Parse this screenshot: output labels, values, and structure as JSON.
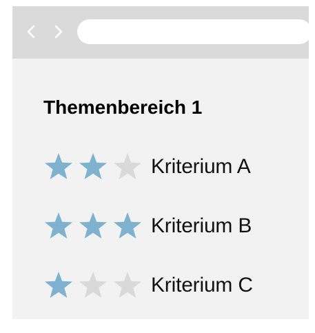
{
  "browser": {
    "back_icon": "chevron-left-icon",
    "forward_icon": "chevron-right-icon",
    "address_value": ""
  },
  "section": {
    "title": "Themenbereich 1"
  },
  "criteria": [
    {
      "label": "Kriterium A",
      "rating": 2,
      "max": 3
    },
    {
      "label": "Kriterium B",
      "rating": 3,
      "max": 3
    },
    {
      "label": "Kriterium C",
      "rating": 1,
      "max": 3
    }
  ],
  "colors": {
    "star_filled": "#7fb2ce",
    "star_empty": "#d9d9d9",
    "chrome": "#dadada",
    "panel": "#f2f2f2"
  }
}
